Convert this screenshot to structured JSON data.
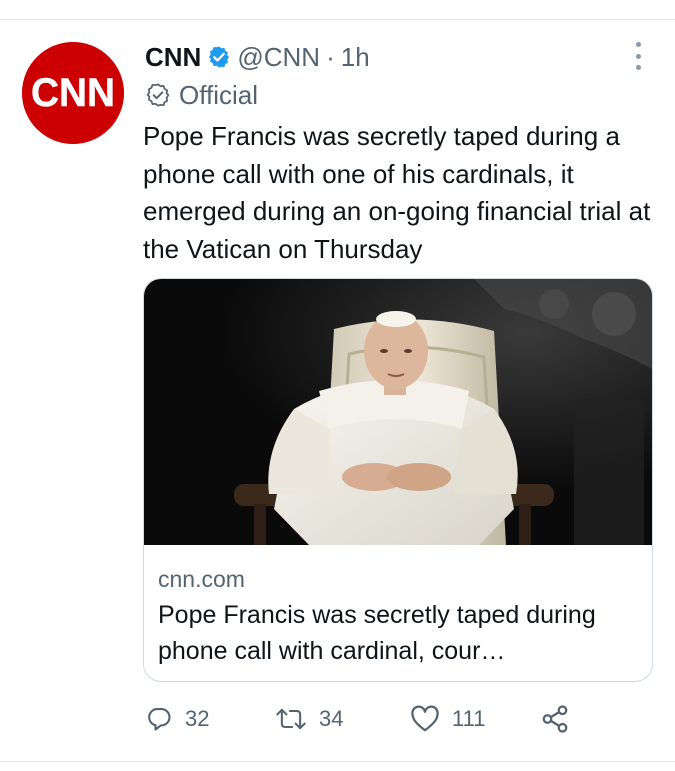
{
  "tweet": {
    "author_name": "CNN",
    "handle": "@CNN",
    "separator": "·",
    "time": "1h",
    "label": "Official",
    "text": "Pope Francis was secretly taped during a phone call with one of his cardinals, it emerged during an on-going financial trial at the Vatican on Thursday",
    "avatar_logo": "CNN"
  },
  "card": {
    "domain": "cnn.com",
    "title": "Pope Francis was secretly taped during phone call with cardinal, cour…"
  },
  "actions": {
    "reply_count": "32",
    "retweet_count": "34",
    "like_count": "111"
  },
  "icons": {
    "verified": "verified-badge-icon",
    "official": "official-badge-icon",
    "more": "more-options-icon",
    "reply": "reply-icon",
    "retweet": "retweet-icon",
    "like": "heart-icon",
    "share": "share-icon"
  },
  "colors": {
    "avatar_red": "#cc0000",
    "verified_blue": "#1d9bf0",
    "text": "#0f1419",
    "secondary": "#536471",
    "border": "#cfd9de"
  }
}
